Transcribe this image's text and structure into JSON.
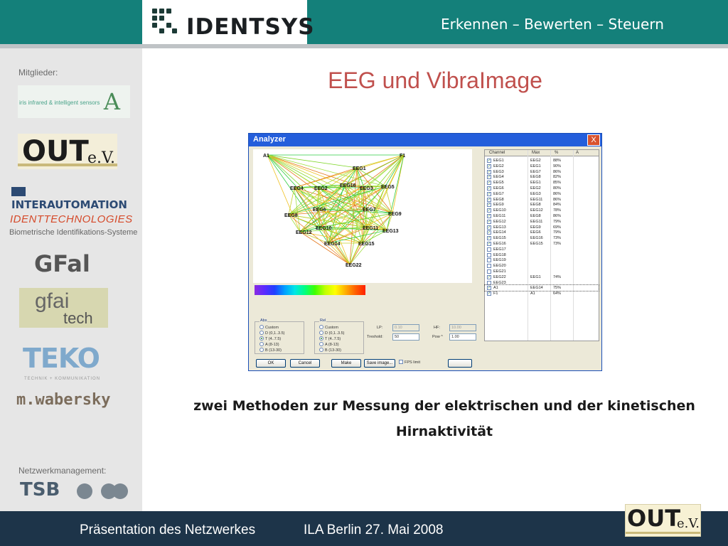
{
  "header": {
    "logo_text": "IDENTSYS",
    "slogan": "Erkennen – Bewerten – Steuern",
    "colors": {
      "teal": "#14807a",
      "stripe": "#bfc3c6"
    }
  },
  "sidebar": {
    "members_label": "Mitglieder:",
    "members": {
      "iris": "iris infrared & intelligent sensors",
      "out": "OUT",
      "out_ev": "e.V.",
      "interautomation": "INTERAUTOMATION",
      "identtech": "IDENTTECHNOLOGIES",
      "identtech_sub": "Biometrische Identifikations-Systeme",
      "gfal": "GFal",
      "gfai_1": "gfai",
      "gfai_2": "tech",
      "teko": "TEKO",
      "teko_sub": "TECHNIK + KOMMUNIKATION",
      "wabersky": "m.wabersky"
    },
    "network_label": "Netzwerkmanagement:",
    "network": {
      "tsb": "TSB"
    }
  },
  "slide": {
    "title": "EEG und VibraImage",
    "description_line1": "zwei Methoden zur Messung der elektrischen und der kinetischen",
    "description_line2": "Hirnaktivität"
  },
  "analyzer": {
    "title": "Analyzer",
    "close": "X",
    "nodes": [
      "A1",
      "F1",
      "EEG1",
      "EEG4",
      "EEG2",
      "EEG16",
      "EEG3",
      "EEG5",
      "EEG8",
      "EEG6",
      "EEG7",
      "EEG9",
      "EEG12",
      "EEG10",
      "EEG11",
      "EEG13",
      "EEG14",
      "EEG15",
      "EEG22"
    ],
    "list_headers": [
      "Channel",
      "Max",
      "%",
      "A"
    ],
    "channels": [
      {
        "ch": "EEG1",
        "max": "EEG2",
        "pct": "88%",
        "checked": true
      },
      {
        "ch": "EEG2",
        "max": "EEG1",
        "pct": "90%",
        "checked": true
      },
      {
        "ch": "EEG3",
        "max": "EEG7",
        "pct": "86%",
        "checked": true
      },
      {
        "ch": "EEG4",
        "max": "EEG8",
        "pct": "82%",
        "checked": true
      },
      {
        "ch": "EEG5",
        "max": "EEG1",
        "pct": "85%",
        "checked": true
      },
      {
        "ch": "EEG6",
        "max": "EEG2",
        "pct": "80%",
        "checked": true
      },
      {
        "ch": "EEG7",
        "max": "EEG3",
        "pct": "86%",
        "checked": true
      },
      {
        "ch": "EEG8",
        "max": "EEG11",
        "pct": "86%",
        "checked": true
      },
      {
        "ch": "EEG9",
        "max": "EEG8",
        "pct": "84%",
        "checked": true
      },
      {
        "ch": "EEG10",
        "max": "EEG12",
        "pct": "78%",
        "checked": true
      },
      {
        "ch": "EEG11",
        "max": "EEG8",
        "pct": "86%",
        "checked": true
      },
      {
        "ch": "EEG12",
        "max": "EEG11",
        "pct": "79%",
        "checked": true
      },
      {
        "ch": "EEG13",
        "max": "EEG9",
        "pct": "69%",
        "checked": true
      },
      {
        "ch": "EEG14",
        "max": "EEG6",
        "pct": "79%",
        "checked": true
      },
      {
        "ch": "EEG15",
        "max": "EEG16",
        "pct": "73%",
        "checked": true
      },
      {
        "ch": "EEG16",
        "max": "EEG15",
        "pct": "73%",
        "checked": true
      },
      {
        "ch": "EEG17",
        "max": "",
        "pct": "",
        "checked": false
      },
      {
        "ch": "EEG18",
        "max": "",
        "pct": "",
        "checked": false
      },
      {
        "ch": "EEG19",
        "max": "",
        "pct": "",
        "checked": false
      },
      {
        "ch": "EEG20",
        "max": "",
        "pct": "",
        "checked": false
      },
      {
        "ch": "EEG21",
        "max": "",
        "pct": "",
        "checked": false
      },
      {
        "ch": "EEG22",
        "max": "EEG1",
        "pct": "74%",
        "checked": true
      },
      {
        "ch": "EEG23",
        "max": "",
        "pct": "",
        "checked": false
      },
      {
        "ch": "A1",
        "max": "EEG14",
        "pct": "75%",
        "checked": true
      },
      {
        "ch": "F1",
        "max": "A1",
        "pct": "64%",
        "checked": true
      }
    ],
    "abs_label": "Abs",
    "rel_label": "Rel",
    "radio_options": [
      "Custom",
      "D (0,1..3.5)",
      "T (4..7.5)",
      "A (8-13)",
      "B (13-30)"
    ],
    "lp_label": "LP:",
    "lp_value": "0.10",
    "hp_label": "HF:",
    "hp_value": "10.00",
    "threshold_label": "Treshold:",
    "threshold_value": "50",
    "pow_label": "Pow ^",
    "pow_value": "1.00",
    "buttons": {
      "ok": "OK",
      "cancel": "Cancel",
      "make": "Make",
      "save": "Save image..."
    },
    "fps_label": "FPS limit"
  },
  "footer": {
    "left": "Präsentation des Netzwerkes",
    "mid": "ILA Berlin  27. Mai 2008",
    "logo_out": "OUT",
    "logo_ev": "e.V.",
    "color": "#1d3449"
  }
}
